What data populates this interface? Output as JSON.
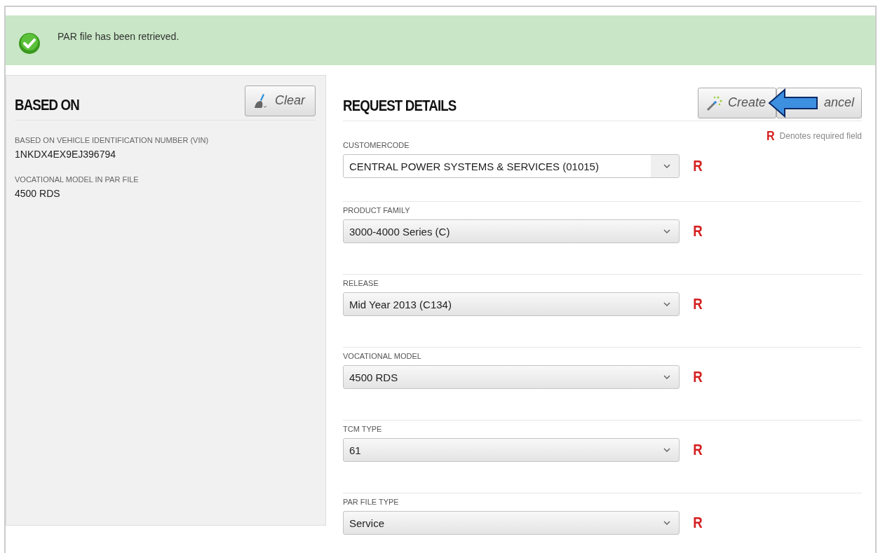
{
  "notice": {
    "kind": "success",
    "message": "PAR file has been retrieved."
  },
  "based_on": {
    "title": "BASED ON",
    "clear_button": "Clear",
    "fields": [
      {
        "label": "BASED ON VEHICLE IDENTIFICATION NUMBER (VIN)",
        "value": "1NKDX4EX9EJ396794"
      },
      {
        "label": "VOCATIONAL MODEL IN PAR FILE",
        "value": "4500 RDS"
      }
    ]
  },
  "request_details": {
    "title": "REQUEST DETAILS",
    "create_button": "Create",
    "cancel_button": "ancel",
    "note_mark": "R",
    "required_note": "Denotes required field",
    "fields": [
      {
        "label": "CUSTOMERCODE",
        "value": "CENTRAL POWER SYSTEMS & SERVICES (01015)",
        "focused": true,
        "required_mark": "R"
      },
      {
        "label": "PRODUCT FAMILY",
        "value": "3000-4000 Series (C)",
        "focused": false,
        "required_mark": "R"
      },
      {
        "label": "RELEASE",
        "value": "Mid Year 2013 (C134)",
        "focused": false,
        "required_mark": "R"
      },
      {
        "label": "VOCATIONAL MODEL",
        "value": "4500 RDS",
        "focused": false,
        "required_mark": "R"
      },
      {
        "label": "TCM TYPE",
        "value": "61",
        "focused": false,
        "required_mark": "R"
      },
      {
        "label": "PAR FILE TYPE",
        "value": "Service",
        "focused": false,
        "required_mark": "R"
      }
    ]
  }
}
